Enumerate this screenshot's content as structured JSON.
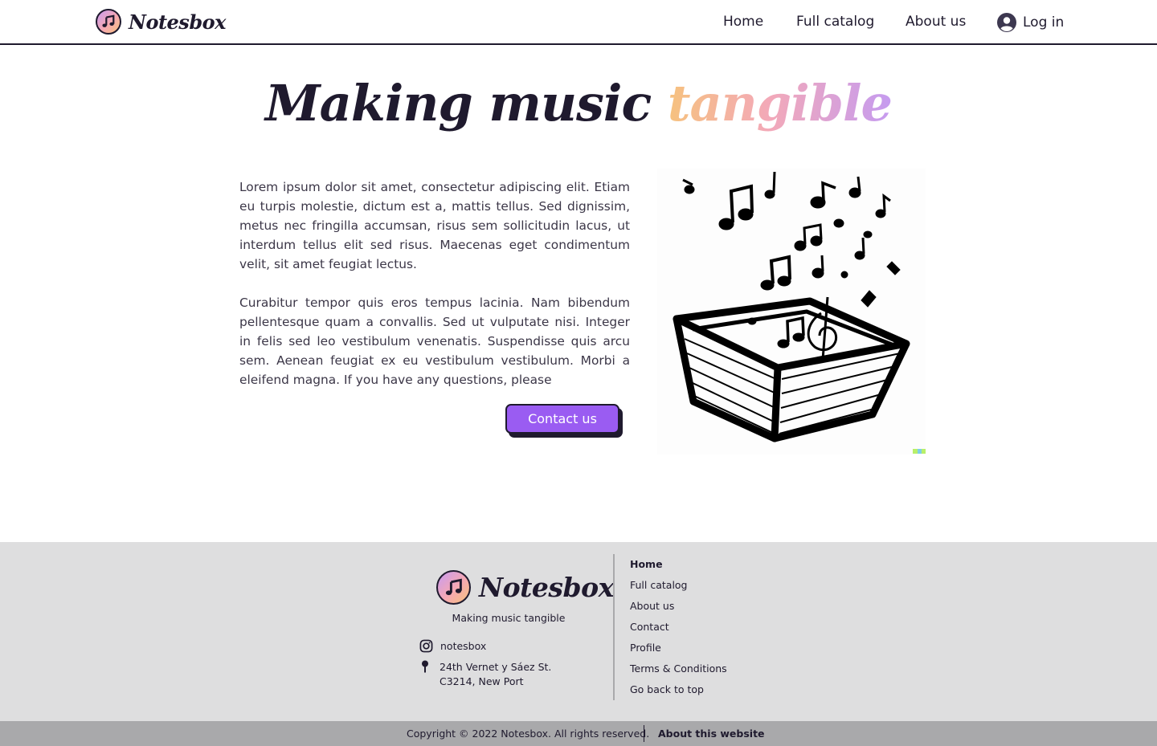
{
  "brand": {
    "name": "Notesbox"
  },
  "header": {
    "nav": [
      "Home",
      "Full catalog",
      "About us"
    ],
    "login_label": "Log in"
  },
  "hero": {
    "title_main": "Making music",
    "title_accent": "tangible",
    "paragraphs": [
      "Lorem ipsum dolor sit amet, consectetur adipiscing elit. Etiam eu turpis molestie, dictum est a, mattis tellus. Sed dignissim, metus nec fringilla accumsan, risus sem sollicitudin lacus, ut interdum tellus elit sed risus. Maecenas eget condimentum velit, sit amet feugiat lectus.",
      "Curabitur tempor quis eros tempus lacinia. Nam bibendum pellentesque quam a convallis. Sed ut vulputate nisi. Integer in felis sed leo vestibulum venenatis. Suspendisse quis arcu sem. Aenean feugiat ex eu vestibulum vestibulum. Morbi a eleifend magna. If you have any questions, please"
    ],
    "contact_label": "Contact us"
  },
  "footer": {
    "tagline": "Making music tangible",
    "instagram": "notesbox",
    "address_line1": "24th Vernet y Sáez St.",
    "address_line2": "C3214, New Port",
    "links": [
      "Home",
      "Full catalog",
      "About us",
      "Contact",
      "Profile",
      "Terms & Conditions",
      "Go back to top"
    ],
    "copyright": "Copyright  © 2022 Notesbox. All rights reserved.",
    "about_site": "About this website"
  },
  "icons": {
    "logo": "music-note-icon",
    "login": "user-circle-icon",
    "instagram": "instagram-icon",
    "location": "pin-icon"
  },
  "colors": {
    "ink": "#1f1a2e",
    "button": "#9a5cf2",
    "footer_bg": "#dededf",
    "copyright_bg": "#a9a9ab"
  }
}
